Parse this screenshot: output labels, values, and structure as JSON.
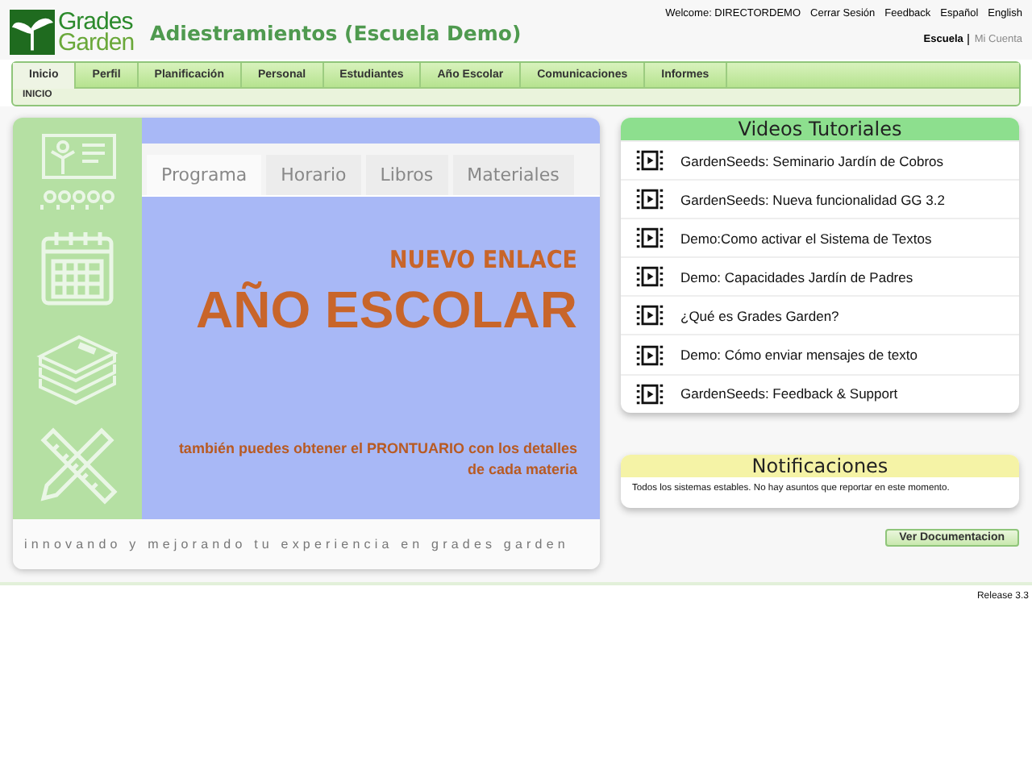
{
  "header": {
    "logo_top": "Grades",
    "logo_bottom": "Garden",
    "title": "Adiestramientos (Escuela Demo)",
    "user_links": [
      "Welcome: DIRECTORDEMO",
      "Cerrar Sesión",
      "Feedback",
      "Español",
      "English"
    ],
    "accounts": [
      {
        "label": "Escuela",
        "selected": true
      },
      {
        "label": "Mi Cuenta",
        "selected": false
      }
    ]
  },
  "nav": {
    "tabs": [
      {
        "label": "Inicio",
        "selected": true
      },
      {
        "label": "Perfil",
        "selected": false
      },
      {
        "label": "Planificación",
        "selected": false
      },
      {
        "label": "Personal",
        "selected": false
      },
      {
        "label": "Estudiantes",
        "selected": false
      },
      {
        "label": "Año Escolar",
        "selected": false
      },
      {
        "label": "Comunicaciones",
        "selected": false
      },
      {
        "label": "Informes",
        "selected": false
      }
    ],
    "breadcrumb": "INICIO"
  },
  "banner": {
    "tabs": [
      {
        "label": "Programa",
        "selected": true
      },
      {
        "label": "Horario",
        "selected": false
      },
      {
        "label": "Libros",
        "selected": false
      },
      {
        "label": "Materiales",
        "selected": false
      }
    ],
    "kicker": "NUEVO ENLACE",
    "headline": "AÑO ESCOLAR",
    "subtext": "también puedes obtener el PRONTUARIO con los detalles de cada materia",
    "footer": "innovando y mejorando tu experiencia en grades garden"
  },
  "videos": {
    "title": "Videos Tutoriales",
    "items": [
      "GardenSeeds: Seminario Jardín de Cobros",
      "GardenSeeds: Nueva funcionalidad GG 3.2",
      "Demo:Como activar el Sistema de Textos",
      "Demo: Capacidades Jardín de Padres",
      "¿Qué es Grades Garden?",
      "Demo: Cómo enviar mensajes de texto",
      "GardenSeeds: Feedback & Support"
    ]
  },
  "notifications": {
    "title": "Notificaciones",
    "message": "Todos los sistemas estables. No hay asuntos que reportar en este momento."
  },
  "doc_button": "Ver Documentacion",
  "release": "Release 3.3"
}
